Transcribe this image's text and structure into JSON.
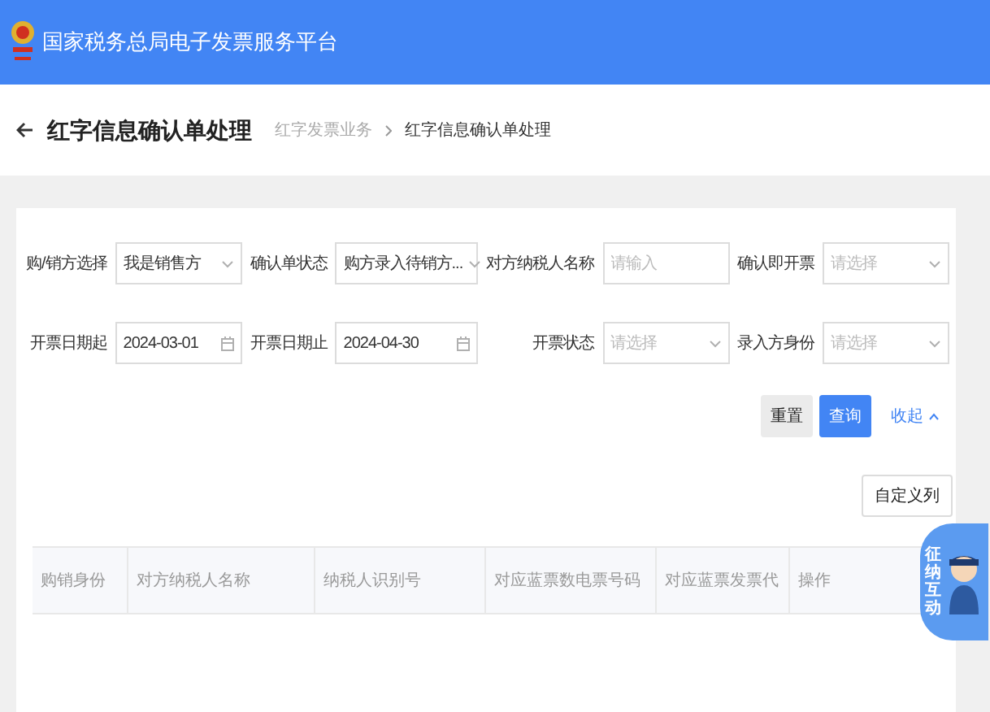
{
  "header": {
    "title": "国家税务总局电子发票服务平台"
  },
  "page": {
    "title": "红字信息确认单处理",
    "breadcrumb": [
      {
        "label": "红字发票业务",
        "selected": false
      },
      {
        "label": "红字信息确认单处理",
        "selected": true
      }
    ]
  },
  "filters": [
    {
      "label": "购/销方选择",
      "kind": "select",
      "value": "我是销售方"
    },
    {
      "label": "确认单状态",
      "kind": "select",
      "value": "购方录入待销方..."
    },
    {
      "label": "对方纳税人名称",
      "kind": "input",
      "placeholder": "请输入"
    },
    {
      "label": "确认即开票",
      "kind": "select",
      "placeholder": "请选择"
    },
    {
      "label": "开票日期起",
      "kind": "date",
      "value": "2024-03-01"
    },
    {
      "label": "开票日期止",
      "kind": "date",
      "value": "2024-04-30"
    },
    {
      "label": "开票状态",
      "kind": "select",
      "placeholder": "请选择"
    },
    {
      "label": "录入方身份",
      "kind": "select",
      "placeholder": "请选择"
    }
  ],
  "actions": {
    "reset": "重置",
    "search": "查询",
    "collapse": "收起"
  },
  "table": {
    "custom_columns": "自定义列",
    "columns": [
      "购销身份",
      "对方纳税人名称",
      "纳税人识别号",
      "对应蓝票数电票号码",
      "对应蓝票发票代",
      "操作"
    ]
  },
  "assistant": {
    "label": "征纳互动"
  }
}
